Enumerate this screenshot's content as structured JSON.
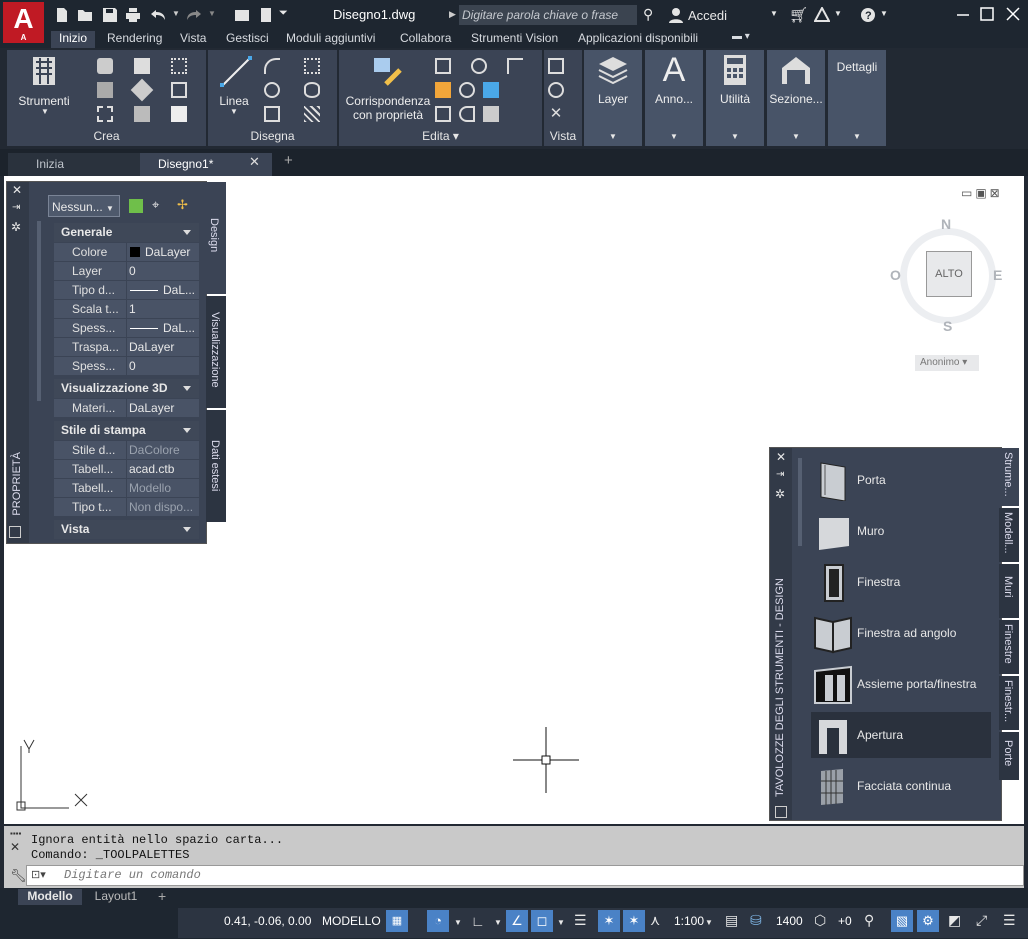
{
  "app": {
    "logo_text": "A",
    "logo_sub": "A",
    "doc_title": "Disegno1.dwg",
    "search_placeholder": "Digitare parola chiave o frase",
    "login": "Accedi"
  },
  "ribbon_tabs": [
    "Inizio",
    "Rendering",
    "Vista",
    "Gestisci",
    "Moduli aggiuntivi",
    "Collabora",
    "Strumenti Vision",
    "Applicazioni disponibili"
  ],
  "panels": {
    "strumenti": "Strumenti",
    "crea": "Crea",
    "linea": "Linea",
    "disegna": "Disegna",
    "corrispondenza": "Corrispondenza",
    "con_proprieta": "con proprietà",
    "edita": "Edita",
    "vista": "Vista",
    "layer": "Layer",
    "anno": "Anno...",
    "utilita": "Utilità",
    "sezione": "Sezione...",
    "dettagli": "Dettagli"
  },
  "file_tabs": {
    "home": "Inizia",
    "drawing": "Disegno1*"
  },
  "properties": {
    "selector": "Nessun...",
    "side_tabs": [
      "Design",
      "Visualizzazione",
      "Dati estesi"
    ],
    "panel_label": "PROPRIETÀ",
    "sections": {
      "generale": "Generale",
      "vis3d": "Visualizzazione 3D",
      "stile": "Stile di stampa",
      "vista": "Vista"
    },
    "rows": [
      {
        "k": "Colore",
        "v": "DaLayer"
      },
      {
        "k": "Layer",
        "v": "0"
      },
      {
        "k": "Tipo d...",
        "v": "DaL..."
      },
      {
        "k": "Scala t...",
        "v": "1"
      },
      {
        "k": "Spess...",
        "v": "DaL..."
      },
      {
        "k": "Traspa...",
        "v": "DaLayer"
      },
      {
        "k": "Spess...",
        "v": "0"
      },
      {
        "k": "Materi...",
        "v": "DaLayer"
      },
      {
        "k": "Stile d...",
        "v": "DaColore"
      },
      {
        "k": "Tabell...",
        "v": "acad.ctb"
      },
      {
        "k": "Tabell...",
        "v": "Modello"
      },
      {
        "k": "Tipo t...",
        "v": "Non dispo..."
      }
    ]
  },
  "viewcube": {
    "n": "N",
    "s": "S",
    "e": "E",
    "w": "O",
    "face": "ALTO",
    "ucs": "Anonimo"
  },
  "ucs_icon": {
    "x": "X",
    "y": "Y"
  },
  "palette": {
    "title": "TAVOLOZZE DEGLI STRUMENTI - DESIGN",
    "tabs": [
      "Strume...",
      "Modell...",
      "Muri",
      "Finestre",
      "Finestr...",
      "Porte"
    ],
    "items": [
      "Porta",
      "Muro",
      "Finestra",
      "Finestra ad angolo",
      "Assieme porta/finestra",
      "Apertura",
      "Facciata continua"
    ]
  },
  "command": {
    "history1": "Ignora entità nello spazio carta...",
    "history2": "Comando: _TOOLPALETTES",
    "placeholder": "Digitare un comando"
  },
  "layout_tabs": {
    "model": "Modello",
    "layout1": "Layout1"
  },
  "status": {
    "coords": "0.41, -0.06, 0.00",
    "mode": "MODELLO",
    "scale": "1:100",
    "lweight": "1400",
    "plus0": "+0"
  }
}
